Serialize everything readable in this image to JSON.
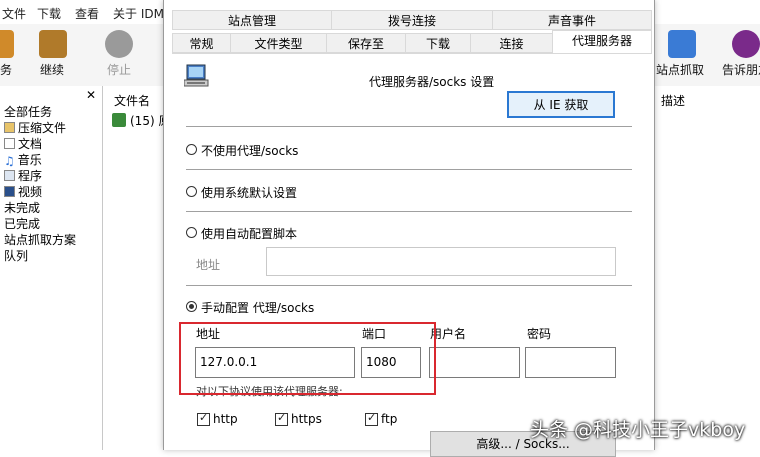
{
  "menubar": {
    "items": [
      "文件",
      "下载",
      "查看",
      "关于 IDM"
    ]
  },
  "toolbar": {
    "left": [
      {
        "label": "务",
        "icon": "task-icon",
        "color": "#d08a2a"
      },
      {
        "label": "继续",
        "icon": "resume-icon",
        "color": "#b07a2a"
      },
      {
        "label": "停止",
        "icon": "stop-icon",
        "color": "#9a9a9a"
      }
    ],
    "right": [
      {
        "label": "站点抓取",
        "icon": "site-grabber-icon",
        "color": "#3a7bd5"
      },
      {
        "label": "告诉朋友",
        "icon": "tell-friend-icon",
        "color": "#7a2a8a"
      }
    ]
  },
  "sidebar": {
    "close_label": "✕",
    "items": [
      {
        "label": "全部任务"
      },
      {
        "label": "压缩文件",
        "icon": "archive-icon"
      },
      {
        "label": "文档",
        "icon": "document-icon"
      },
      {
        "label": "音乐",
        "icon": "music-icon"
      },
      {
        "label": "程序",
        "icon": "program-icon"
      },
      {
        "label": "视频",
        "icon": "video-icon"
      },
      {
        "label": "未完成"
      },
      {
        "label": "已完成"
      },
      {
        "label": "站点抓取方案"
      },
      {
        "label": "队列"
      }
    ]
  },
  "filelist": {
    "header": "文件名",
    "row": "(15) 原"
  },
  "rightpanel": {
    "header": "描述"
  },
  "dialog": {
    "tabs_row1": [
      "站点管理",
      "拨号连接",
      "声音事件"
    ],
    "tabs_row2": [
      "常规",
      "文件类型",
      "保存至",
      "下载",
      "连接",
      "代理服务器"
    ],
    "active_tab": "代理服务器",
    "title": "代理服务器/socks 设置",
    "get_from_ie": "从 IE 获取",
    "options": {
      "no_proxy": "不使用代理/socks",
      "system_default": "使用系统默认设置",
      "auto_script": "使用自动配置脚本",
      "manual": "手动配置 代理/socks"
    },
    "script_address_label": "地址",
    "script_address_value": "",
    "manual_fields": {
      "address_label": "地址",
      "address_value": "127.0.0.1",
      "port_label": "端口",
      "port_value": "1080",
      "username_label": "用户名",
      "username_value": "",
      "password_label": "密码",
      "password_value": ""
    },
    "protocols_label": "对以下协议使用该代理服务器:",
    "protocols": [
      "http",
      "https",
      "ftp"
    ],
    "advanced_button": "高级... / Socks..."
  },
  "highlight_color": "#d9282f",
  "watermark": "头条 @科技小王子vkboy"
}
